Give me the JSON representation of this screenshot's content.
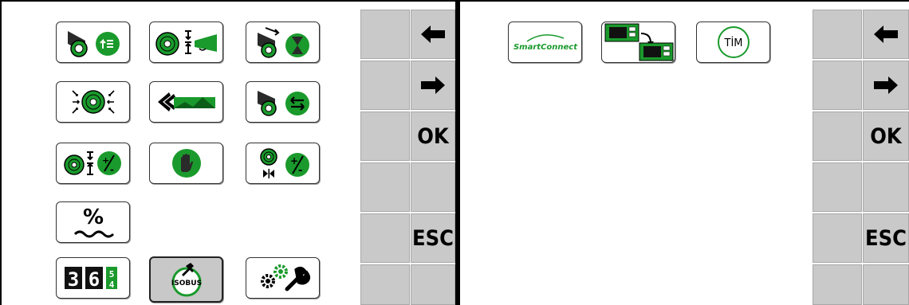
{
  "left_panel": {
    "buttons": [
      {
        "icon": "bale-unload-icon"
      },
      {
        "icon": "bale-eject-height-icon"
      },
      {
        "icon": "bale-timer-icon"
      },
      {
        "icon": "bale-size-icon"
      },
      {
        "icon": "reverse-feed-icon"
      },
      {
        "icon": "bale-direction-icon"
      },
      {
        "icon": "bale-height-adjust-icon"
      },
      {
        "icon": "stop-hand-icon"
      },
      {
        "icon": "bale-pressure-adjust-icon"
      },
      {
        "icon": "moisture-percent-icon",
        "label": "%"
      },
      {
        "icon": "counter-icon",
        "digits": [
          "3",
          "6",
          "5",
          "4"
        ]
      },
      {
        "icon": "isobus-icon",
        "label": "ISOBUS"
      },
      {
        "icon": "settings-icon"
      }
    ],
    "softkeys": {
      "left_arrow": "🡐",
      "right_arrow": "🡒",
      "ok": "OK",
      "esc": "ESC"
    }
  },
  "right_panel": {
    "buttons": [
      {
        "icon": "smartconnect-icon",
        "label": "SmartConnect"
      },
      {
        "icon": "screen-switch-icon"
      },
      {
        "icon": "tim-icon",
        "label": "TİM"
      }
    ],
    "softkeys": {
      "left_arrow": "🡐",
      "right_arrow": "🡒",
      "ok": "OK",
      "esc": "ESC"
    }
  },
  "colors": {
    "green": "#1a9a2c",
    "dark_green": "#0b5e18",
    "grey": "#c9c9c9"
  }
}
